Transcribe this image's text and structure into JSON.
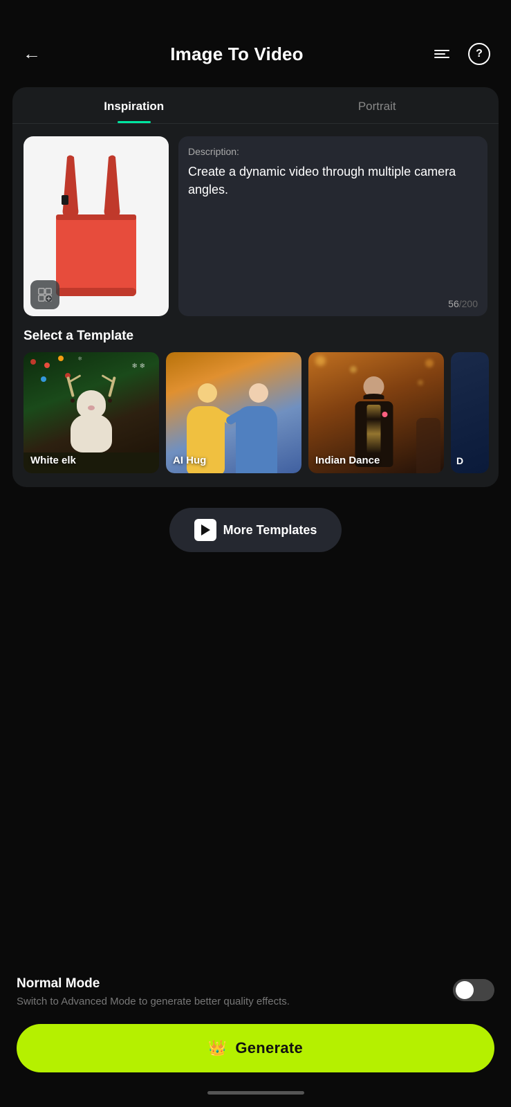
{
  "header": {
    "title": "Image To Video",
    "back_label": "back",
    "list_icon_label": "list-icon",
    "help_icon_label": "help"
  },
  "tabs": [
    {
      "id": "inspiration",
      "label": "Inspiration",
      "active": true
    },
    {
      "id": "portrait",
      "label": "Portrait",
      "active": false
    }
  ],
  "description": {
    "label": "Description:",
    "text": "Create a dynamic video through multiple camera angles.",
    "char_current": "56",
    "char_max": "200"
  },
  "select_template": {
    "section_title": "Select a Template",
    "templates": [
      {
        "id": "white-elk",
        "label": "White elk"
      },
      {
        "id": "ai-hug",
        "label": "AI Hug"
      },
      {
        "id": "indian-dance",
        "label": "Indian Dance"
      },
      {
        "id": "more-partial",
        "label": "D"
      }
    ]
  },
  "more_templates": {
    "label": "More Templates"
  },
  "normal_mode": {
    "title": "Normal Mode",
    "description": "Switch to Advanced Mode to generate better quality effects.",
    "toggle_on": false
  },
  "generate_button": {
    "label": "Generate",
    "icon": "👑"
  },
  "edit_icon": "✏️"
}
